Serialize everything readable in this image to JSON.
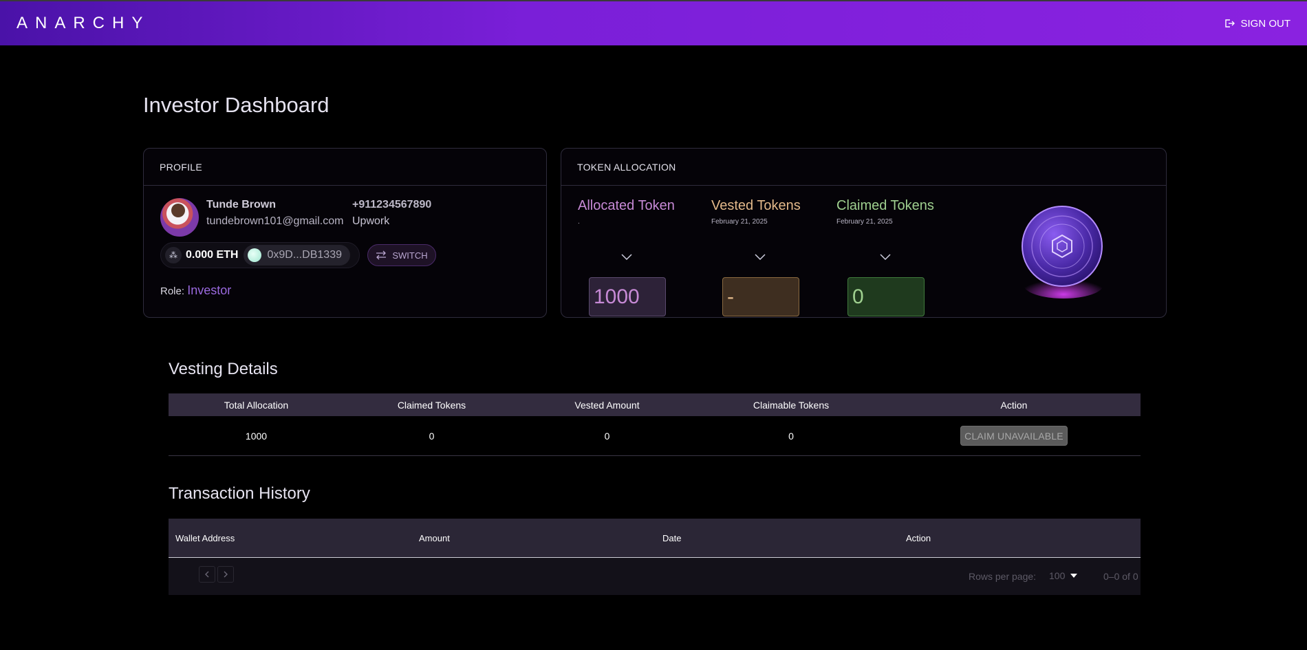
{
  "header": {
    "logo": "ANARCHY",
    "signout_label": "SIGN OUT"
  },
  "page": {
    "title": "Investor Dashboard"
  },
  "profile": {
    "heading": "PROFILE",
    "name": "Tunde Brown",
    "email": "tundebrown101@gmail.com",
    "phone": "+911234567890",
    "company": "Upwork",
    "eth_balance": "0.000 ETH",
    "wallet_address": "0x9D...DB1339",
    "switch_label": "SWITCH",
    "role_label": "Role:",
    "role_value": "Investor"
  },
  "tokens": {
    "heading": "TOKEN ALLOCATION",
    "allocated": {
      "title": "Allocated Token",
      "date": ".",
      "value": "1000",
      "color": "#c78ad6"
    },
    "vested": {
      "title": "Vested Tokens",
      "date": "February 21, 2025",
      "value": "-",
      "color": "#e3b98a"
    },
    "claimed": {
      "title": "Claimed Tokens",
      "date": "February 21, 2025",
      "value": "0",
      "color": "#9fd08f"
    }
  },
  "vesting": {
    "title": "Vesting Details",
    "columns": [
      "Total Allocation",
      "Claimed Tokens",
      "Vested Amount",
      "Claimable Tokens",
      "Action"
    ],
    "row": {
      "total": "1000",
      "claimed": "0",
      "vested": "0",
      "claimable": "0",
      "action": "CLAIM UNAVAILABLE"
    }
  },
  "transactions": {
    "title": "Transaction History",
    "columns": [
      "Wallet Address",
      "Amount",
      "Date",
      "Action"
    ],
    "rows_per_page_label": "Rows per page:",
    "rows_per_page_value": "100",
    "range_text": "0–0 of 0"
  }
}
